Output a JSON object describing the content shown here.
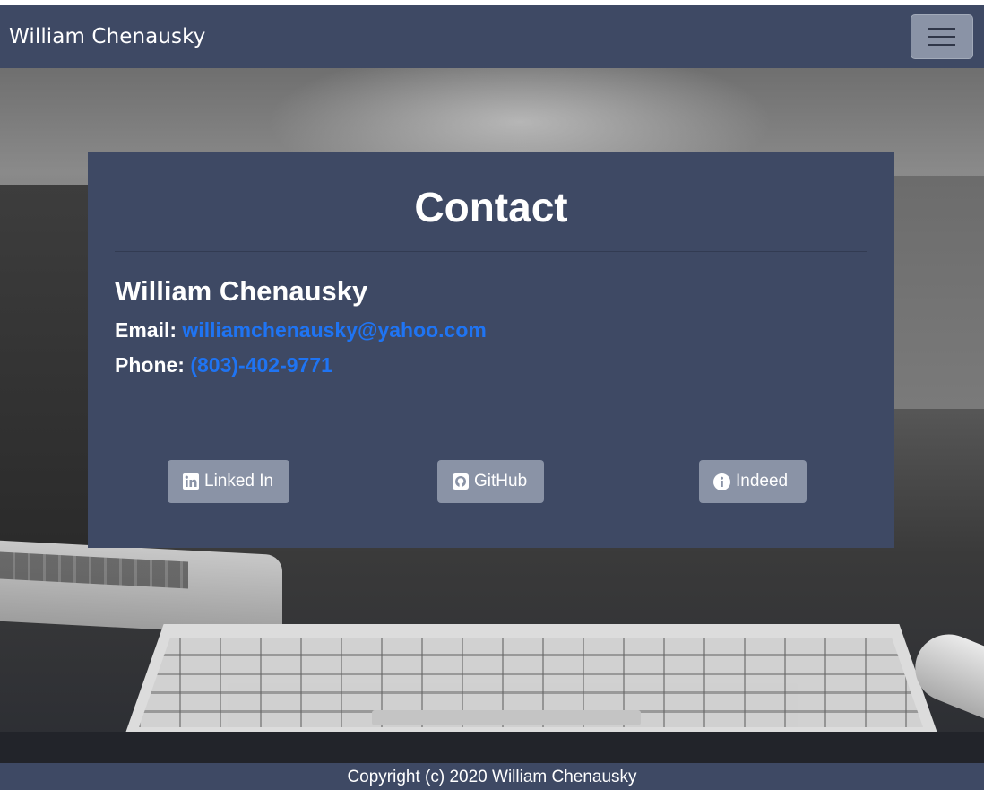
{
  "navbar": {
    "brand": "William Chenausky",
    "toggler_icon": "hamburger-menu-icon"
  },
  "contact": {
    "title": "Contact",
    "name": "William Chenausky",
    "email_label": "Email:",
    "email_value": "williamchenausky@yahoo.com",
    "phone_label": "Phone:",
    "phone_value": "(803)-402-9771"
  },
  "social": {
    "linkedin": {
      "label": "Linked In",
      "icon": "linkedin-icon"
    },
    "github": {
      "label": "GitHub",
      "icon": "github-icon"
    },
    "indeed": {
      "label": "Indeed",
      "icon": "info-circle-icon"
    }
  },
  "footer": {
    "copyright": "Copyright (c) 2020 William Chenausky"
  },
  "colors": {
    "navbar_bg": "#3e4964",
    "button_bg": "#8a93a6",
    "link": "#1f74f3"
  }
}
